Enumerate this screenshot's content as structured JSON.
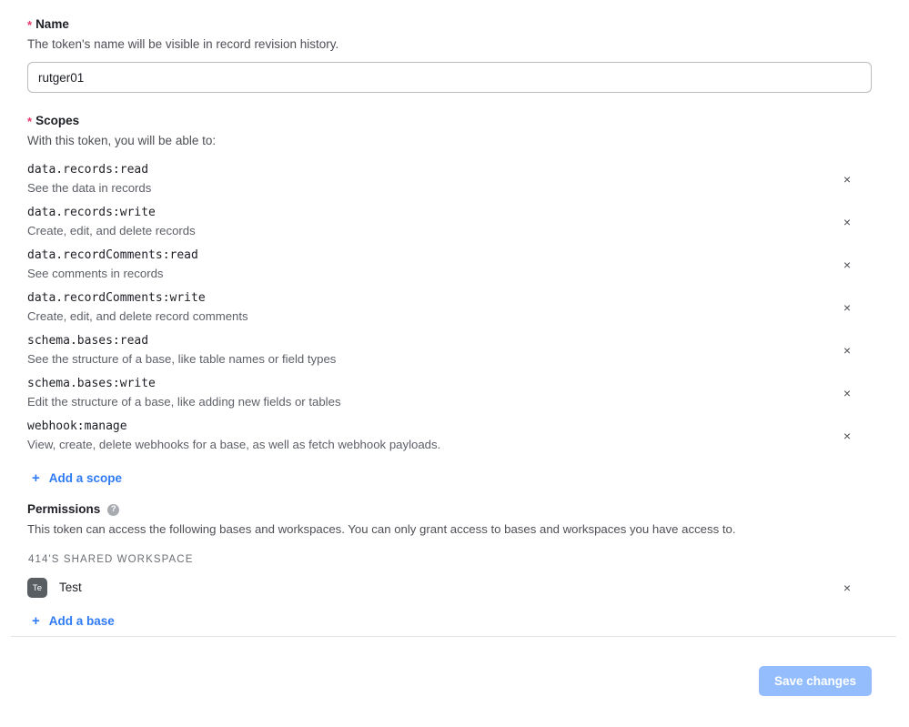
{
  "name_field": {
    "label": "Name",
    "required_marker": "*",
    "help": "The token's name will be visible in record revision history.",
    "value": "rutger01",
    "placeholder": ""
  },
  "scopes_section": {
    "label": "Scopes",
    "required_marker": "*",
    "help": "With this token, you will be able to:",
    "remove_icon": "×",
    "items": [
      {
        "name": "data.records:read",
        "description": "See the data in records"
      },
      {
        "name": "data.records:write",
        "description": "Create, edit, and delete records"
      },
      {
        "name": "data.recordComments:read",
        "description": "See comments in records"
      },
      {
        "name": "data.recordComments:write",
        "description": "Create, edit, and delete record comments"
      },
      {
        "name": "schema.bases:read",
        "description": "See the structure of a base, like table names or field types"
      },
      {
        "name": "schema.bases:write",
        "description": "Edit the structure of a base, like adding new fields or tables"
      },
      {
        "name": "webhook:manage",
        "description": "View, create, delete webhooks for a base, as well as fetch webhook payloads."
      }
    ],
    "add_scope_label": "Add a scope",
    "add_icon": "+"
  },
  "permissions_section": {
    "title": "Permissions",
    "help_icon": "?",
    "description": "This token can access the following bases and workspaces. You can only grant access to bases and workspaces you have access to.",
    "workspace_label": "414'S SHARED WORKSPACE",
    "bases": [
      {
        "initials": "Te",
        "name": "Test",
        "remove_icon": "×"
      }
    ],
    "add_base_label": "Add a base",
    "add_icon": "+"
  },
  "footer": {
    "save_label": "Save changes"
  },
  "colors": {
    "required_star": "#e8386c",
    "link_blue": "#2f7bf6",
    "save_button": "#93bdfc",
    "base_avatar": "#595e63",
    "divider": "#e3e4e6",
    "body_text": "#1d1f25",
    "muted_text": "#5c5f66"
  }
}
